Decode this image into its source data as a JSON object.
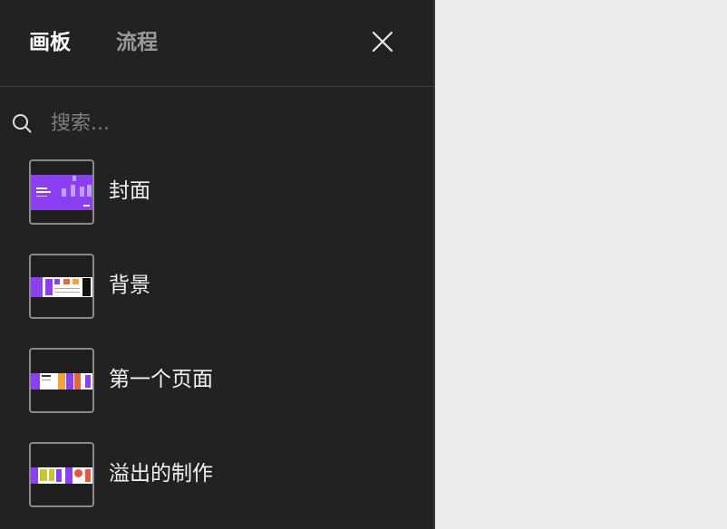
{
  "tabs": [
    {
      "label": "画板",
      "active": true
    },
    {
      "label": "流程",
      "active": false
    }
  ],
  "search": {
    "placeholder": "搜索..."
  },
  "boards": [
    {
      "label": "封面"
    },
    {
      "label": "背景"
    },
    {
      "label": "第一个页面"
    },
    {
      "label": "溢出的制作"
    }
  ],
  "colors": {
    "panel_bg": "#222222",
    "canvas_bg": "#ebebeb",
    "accent_purple": "#8a3ff0",
    "thumb_border": "#8a8a8a"
  },
  "icons": {
    "close": "close-icon",
    "search": "search-icon"
  }
}
